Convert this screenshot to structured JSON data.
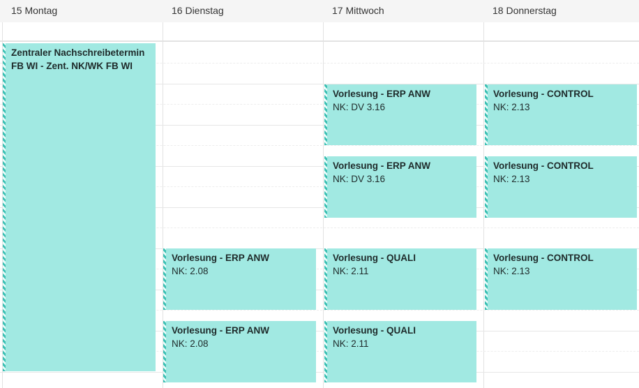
{
  "days": [
    {
      "label": "15 Montag"
    },
    {
      "label": "16 Dienstag"
    },
    {
      "label": "17 Mittwoch"
    },
    {
      "label": "18 Donnerstag"
    }
  ],
  "events": [
    {
      "title": "Zentraler Nachschreibetermin FB WI - Zent. NK/WK FB WI",
      "sub": ""
    },
    {
      "title": "Vorlesung - ERP ANW",
      "sub": "NK: 2.08"
    },
    {
      "title": "Vorlesung - ERP ANW",
      "sub": "NK: 2.08"
    },
    {
      "title": "Vorlesung - ERP ANW",
      "sub": "NK: DV 3.16"
    },
    {
      "title": "Vorlesung - ERP ANW",
      "sub": "NK: DV 3.16"
    },
    {
      "title": "Vorlesung - QUALI",
      "sub": "NK: 2.11"
    },
    {
      "title": "Vorlesung - QUALI",
      "sub": "NK: 2.11"
    },
    {
      "title": "Vorlesung - CONTROL",
      "sub": "NK: 2.13"
    },
    {
      "title": "Vorlesung - CONTROL",
      "sub": "NK: 2.13"
    },
    {
      "title": "Vorlesung - CONTROL",
      "sub": "NK: 2.13"
    }
  ],
  "colors": {
    "event_fill": "#a1e9e2",
    "event_stripe": "#3cc0b4",
    "header_bg": "#f5f5f5"
  }
}
